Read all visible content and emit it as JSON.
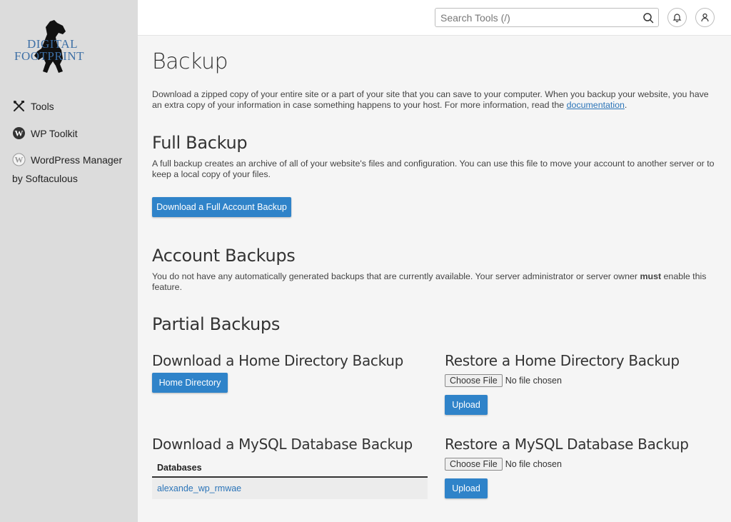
{
  "brand": {
    "logo_line1": "DIGITAL",
    "logo_line2": "FOOTPRINT"
  },
  "sidebar": {
    "items": [
      {
        "label": "Tools",
        "icon": "tools-icon"
      },
      {
        "label": "WP Toolkit",
        "icon": "wordpress-icon"
      },
      {
        "label": "WordPress Manager",
        "label_line2": "by Softaculous",
        "icon": "wordpress-icon"
      }
    ]
  },
  "header": {
    "search_placeholder": "Search Tools (/)",
    "icons": [
      "search-icon",
      "bell-icon",
      "user-icon"
    ]
  },
  "main": {
    "title": "Backup",
    "intro": "Download a zipped copy of your entire site or a part of your site that you can save to your computer. When you backup your website, you have an extra copy of your information in case something happens to your host. For more information, read the ",
    "intro_link": "documentation",
    "intro_end": ".",
    "full_backup": {
      "heading": "Full Backup",
      "text": "A full backup creates an archive of all of your website's files and configuration. You can use this file to move your account to another server or to keep a local copy of your files.",
      "button": "Download a Full Account Backup"
    },
    "account_backups": {
      "heading": "Account Backups",
      "text_before": "You do not have any automatically generated backups that are currently available. Your server administrator or server owner ",
      "text_bold": "must",
      "text_after": " enable this feature."
    },
    "partial_backups": {
      "heading": "Partial Backups",
      "download_home_heading": "Download a Home Directory Backup",
      "home_button": "Home Directory",
      "restore_home_heading": "Restore a Home Directory Backup",
      "choose_file": "Choose File",
      "no_file": "No file chosen",
      "upload": "Upload",
      "download_sql_heading": "Download a MySQL Database Backup",
      "databases_header": "Databases",
      "databases": [
        "alexande_wp_rmwae"
      ],
      "restore_sql_heading": "Restore a MySQL Database Backup"
    }
  },
  "colors": {
    "accent": "#2f83c9",
    "sidebar_bg": "#dcdcdc",
    "link": "#2b74b8"
  }
}
